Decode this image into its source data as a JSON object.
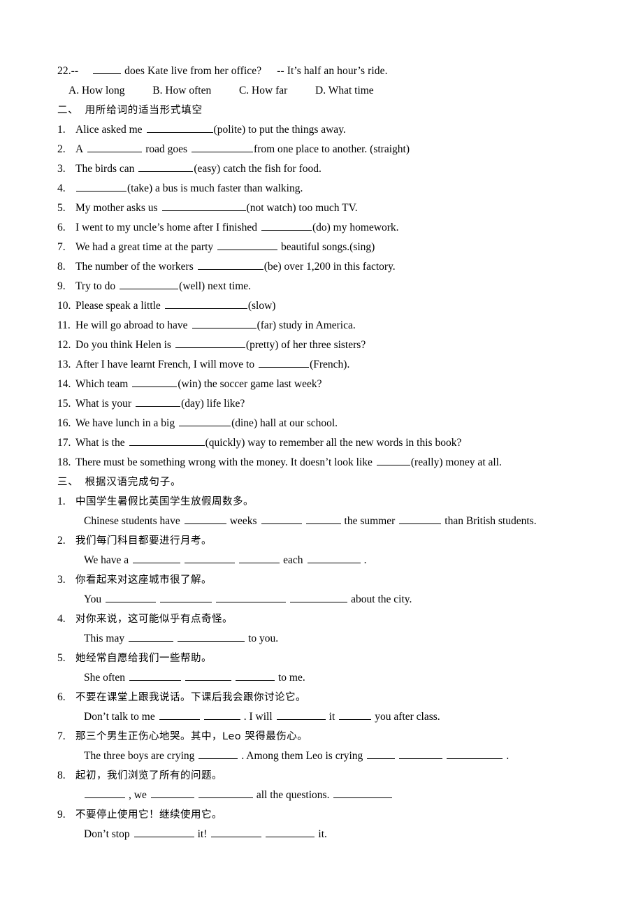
{
  "document": {
    "type": "english-grammar-worksheet",
    "language_mix": "English / Chinese"
  },
  "q22": {
    "number": "22.--",
    "stem_after_blank": "does Kate live from her office?",
    "answer_part": "-- It’s half an hour’s ride.",
    "options": [
      "A. How long",
      "B. How often",
      "C. How far",
      "D. What time"
    ]
  },
  "section_two": {
    "marker": "二、",
    "title": "用所给词的适当形式填空",
    "items": [
      {
        "num": "1.",
        "pre": "Alice asked me",
        "blank": 95,
        "post": "(polite) to put the things away."
      },
      {
        "num": "2.",
        "pre": "A",
        "blank": 78,
        "mid": "road goes",
        "blank2": 88,
        "post": "from one place to another. (straight)"
      },
      {
        "num": "3.",
        "pre": "The birds can",
        "blank": 78,
        "post": "(easy) catch the fish for food."
      },
      {
        "num": "4.",
        "pre": "",
        "blank": 72,
        "post": "(take) a bus is much faster than walking."
      },
      {
        "num": "5.",
        "pre": "My mother asks us",
        "blank": 120,
        "post": "(not watch) too much TV."
      },
      {
        "num": "6.",
        "pre": "I went to my uncle’s home after I finished",
        "blank": 72,
        "post": "(do) my homework."
      },
      {
        "num": "7.",
        "pre": "We had a great time at the party",
        "blank": 86,
        "post": " beautiful songs.(sing)"
      },
      {
        "num": "8.",
        "pre": "The number of the workers",
        "blank": 94,
        "post": "(be) over 1,200 in this factory."
      },
      {
        "num": "9.",
        "pre": "Try to do",
        "blank": 84,
        "post": "(well) next time."
      },
      {
        "num": "10.",
        "pre": "Please speak a little",
        "blank": 118,
        "post": "(slow)"
      },
      {
        "num": "11.",
        "pre": "He will go abroad to have",
        "blank": 92,
        "post": "(far) study in America."
      },
      {
        "num": "12.",
        "pre": "Do you think Helen is",
        "blank": 100,
        "post": "(pretty) of her three sisters?"
      },
      {
        "num": "13.",
        "pre": "After I have learnt French, I will move to",
        "blank": 72,
        "post": "(French)."
      },
      {
        "num": "14.",
        "pre": "Which team",
        "blank": 64,
        "post": "(win) the soccer game last week?"
      },
      {
        "num": "15.",
        "pre": "What is your",
        "blank": 64,
        "post": "(day) life like?"
      },
      {
        "num": "16.",
        "pre": "We have lunch in a big",
        "blank": 74,
        "post": "(dine) hall at our school."
      },
      {
        "num": "17.",
        "pre": "What is the",
        "blank": 108,
        "post": "(quickly) way to remember all the new words in this book?"
      },
      {
        "num": "18.",
        "pre": "There must be something wrong with the money. It doesn’t look like",
        "blank": 48,
        "post": "(really) money at all."
      }
    ]
  },
  "section_three": {
    "marker": "三、",
    "title": "根据汉语完成句子。",
    "items": [
      {
        "num": "1.",
        "chinese": "中国学生暑假比英国学生放假周数多。",
        "answer_parts": [
          "Chinese students have",
          "weeks",
          "",
          "the summer",
          "than British students."
        ],
        "blanks": [
          60,
          58,
          50,
          60
        ]
      },
      {
        "num": "2.",
        "chinese": "我们每门科目都要进行月考。",
        "answer_parts": [
          "We have a",
          "",
          "",
          "each",
          "."
        ],
        "blanks": [
          68,
          72,
          58,
          76
        ]
      },
      {
        "num": "3.",
        "chinese": "你看起来对这座城市很了解。",
        "answer_parts": [
          "You",
          "",
          "",
          "",
          "about the city."
        ],
        "blanks": [
          72,
          74,
          100,
          82
        ]
      },
      {
        "num": "4.",
        "chinese": "对你来说，这可能似乎有点奇怪。",
        "answer_parts": [
          "This may",
          "",
          "to you."
        ],
        "blanks": [
          64,
          96
        ]
      },
      {
        "num": "5.",
        "chinese": "她经常自愿给我们一些帮助。",
        "answer_parts": [
          "She often",
          "",
          "",
          "to me."
        ],
        "blanks": [
          74,
          66,
          56
        ]
      },
      {
        "num": "6.",
        "chinese": "不要在课堂上跟我说话。下课后我会跟你讨论它。",
        "answer_parts": [
          "Don’t talk to me",
          "",
          ". I will",
          "it",
          "you after class."
        ],
        "blanks": [
          58,
          52,
          70,
          46
        ]
      },
      {
        "num": "7.",
        "chinese": "那三个男生正伤心地哭。其中，Leo 哭得最伤心。",
        "answer_parts": [
          "The three boys are crying",
          ". Among them Leo is crying",
          "",
          "",
          "."
        ],
        "blanks": [
          56,
          40,
          62,
          80
        ]
      },
      {
        "num": "8.",
        "chinese": "起初，我们浏览了所有的问题。",
        "answer_parts": [
          "",
          ", we",
          "",
          "all the questions."
        ],
        "blanks": [
          58,
          62,
          78,
          84
        ]
      },
      {
        "num": "9.",
        "chinese": "不要停止使用它！继续使用它。",
        "answer_parts": [
          "Don’t stop",
          "it!",
          "",
          "it."
        ],
        "blanks": [
          86,
          72,
          70
        ]
      }
    ]
  }
}
